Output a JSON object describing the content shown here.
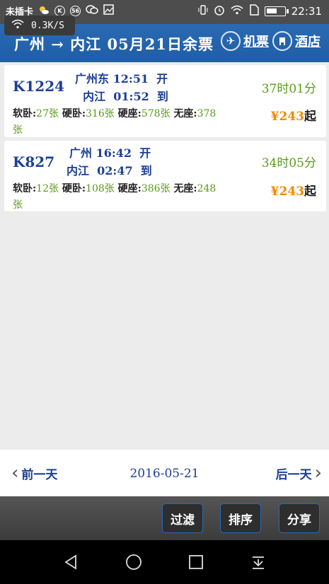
{
  "status_bar": {
    "carrier": "未插卡",
    "icons": [
      "weather-icon",
      "k-badge-icon",
      "56-badge-icon",
      "wechat-icon",
      "image-icon"
    ],
    "k_badge": "K",
    "badge_56": "56",
    "right_icons": [
      "vibrate-icon",
      "alarm-icon",
      "wifi-icon",
      "sim-icon",
      "battery-icon"
    ],
    "time": "22:31",
    "battery_level": 0.6,
    "net_speed": "0.3K/S"
  },
  "header": {
    "title": "广州 → 内江  05月21日余票",
    "flight_label": "机票",
    "hotel_label": "酒店"
  },
  "trains": [
    {
      "number": "K1224",
      "depart_line": "广州东 12:51  开",
      "arrive_line": "  内江  01:52  到",
      "duration": "37时01分",
      "price_symbol": "¥243",
      "price_suffix": "起",
      "seats": [
        {
          "label": "软卧:",
          "count": "27张"
        },
        {
          "label": "硬卧:",
          "count": "316张"
        },
        {
          "label": "硬座:",
          "count": "578张"
        },
        {
          "label": "无座:",
          "count": "378张"
        }
      ]
    },
    {
      "number": "K827",
      "depart_line": "广州 16:42  开",
      "arrive_line": "内江  02:47  到",
      "duration": "34时05分",
      "price_symbol": "¥243",
      "price_suffix": "起",
      "seats": [
        {
          "label": "软卧:",
          "count": "12张"
        },
        {
          "label": "硬卧:",
          "count": "108张"
        },
        {
          "label": "硬座:",
          "count": "386张"
        },
        {
          "label": "无座:",
          "count": "248张"
        }
      ]
    }
  ],
  "date_nav": {
    "prev_label": "前一天",
    "current_date": "2016-05-21",
    "next_label": "后一天"
  },
  "actions": {
    "filter_label": "过滤",
    "sort_label": "排序",
    "share_label": "分享"
  },
  "colors": {
    "header_blue": "#2166ae",
    "train_text": "#1c3f96",
    "duration_green": "#5a9a16",
    "price_orange": "#f08a00"
  }
}
